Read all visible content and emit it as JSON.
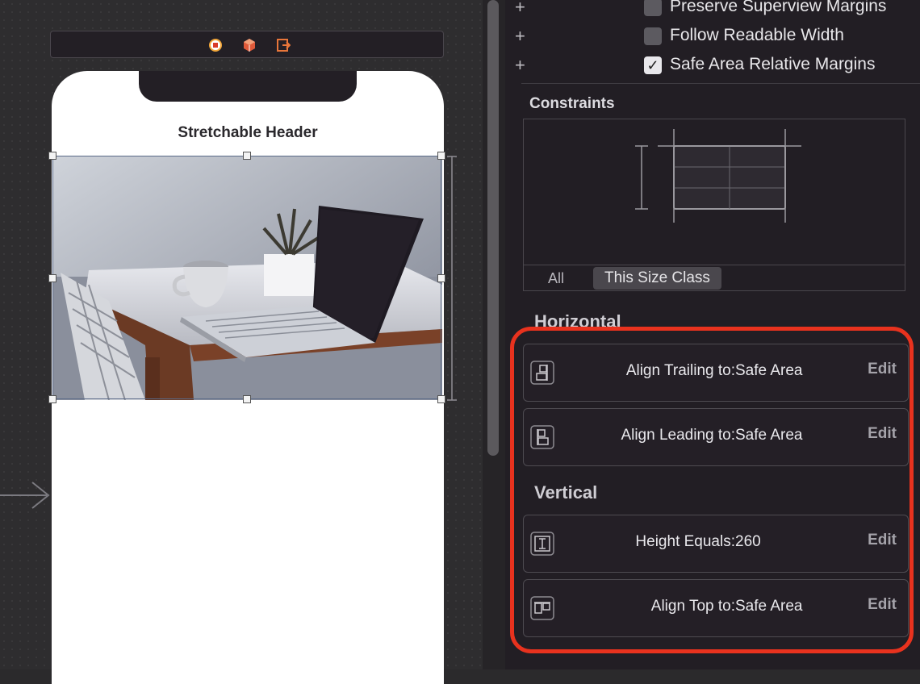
{
  "canvas": {
    "scene_bar_icons": [
      "stop-circle-icon",
      "cube-icon",
      "exit-icon"
    ],
    "nav_title": "Stretchable Header",
    "header_image_alt": "laptop-on-desk-photo"
  },
  "inspector": {
    "checkboxes": [
      {
        "label": "Preserve Superview Margins",
        "checked": false
      },
      {
        "label": "Follow Readable Width",
        "checked": false
      },
      {
        "label": "Safe Area Relative Margins",
        "checked": true
      }
    ],
    "constraints_title": "Constraints",
    "size_tabs": {
      "all": "All",
      "size_class": "This Size Class"
    },
    "horizontal_title": "Horizontal",
    "vertical_title": "Vertical",
    "horizontal_constraints": [
      {
        "label": "Align Trailing to:",
        "value": "Safe Area",
        "edit": "Edit",
        "icon": "align-trailing-icon"
      },
      {
        "label": "Align Leading to:",
        "value": "Safe Area",
        "edit": "Edit",
        "icon": "align-leading-icon"
      }
    ],
    "vertical_constraints": [
      {
        "label": "Height Equals:",
        "value": "260",
        "edit": "Edit",
        "icon": "height-icon"
      },
      {
        "label": "Align Top to:",
        "value": "Safe Area",
        "edit": "Edit",
        "icon": "align-top-icon"
      }
    ],
    "highlight_color": "#e8321e"
  }
}
